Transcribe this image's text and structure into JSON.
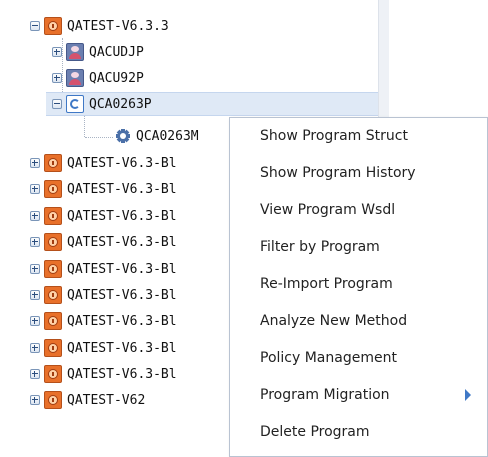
{
  "tree": {
    "items": [
      {
        "label": "QATEST-V6.3.3",
        "icon": "system-icon",
        "expander": "collapse"
      },
      {
        "label": "QACUDJP",
        "icon": "library-icon",
        "expander": "expand"
      },
      {
        "label": "QACU92P",
        "icon": "library-icon",
        "expander": "expand"
      },
      {
        "label": "QCA0263P",
        "icon": "program-icon",
        "expander": "collapse"
      },
      {
        "label": "QCA0263M",
        "icon": "gear-icon",
        "expander": "none"
      },
      {
        "label": "QATEST-V6.3-Bl",
        "icon": "system-icon",
        "expander": "expand"
      },
      {
        "label": "QATEST-V6.3-Bl",
        "icon": "system-icon",
        "expander": "expand"
      },
      {
        "label": "QATEST-V6.3-Bl",
        "icon": "system-icon",
        "expander": "expand"
      },
      {
        "label": "QATEST-V6.3-Bl",
        "icon": "system-icon",
        "expander": "expand"
      },
      {
        "label": "QATEST-V6.3-Bl",
        "icon": "system-icon",
        "expander": "expand"
      },
      {
        "label": "QATEST-V6.3-Bl",
        "icon": "system-icon",
        "expander": "expand"
      },
      {
        "label": "QATEST-V6.3-Bl",
        "icon": "system-icon",
        "expander": "expand"
      },
      {
        "label": "QATEST-V6.3-Bl",
        "icon": "system-icon",
        "expander": "expand"
      },
      {
        "label": "QATEST-V6.3-Bl",
        "icon": "system-icon",
        "expander": "expand"
      },
      {
        "label": "QATEST-V62",
        "icon": "system-icon",
        "expander": "expand"
      }
    ]
  },
  "context_menu": {
    "items": [
      {
        "label": "Show Program Struct"
      },
      {
        "label": "Show Program History"
      },
      {
        "label": "View Program Wsdl"
      },
      {
        "label": "Filter by Program"
      },
      {
        "label": "Re-Import Program"
      },
      {
        "label": "Analyze New Method"
      },
      {
        "label": "Policy Management"
      },
      {
        "label": "Program Migration",
        "submenu": true
      },
      {
        "label": "Delete Program"
      }
    ]
  },
  "colors": {
    "selected_row": "#dfe9f6",
    "menu_border": "#b9c3d2",
    "system_icon": "#e8702a",
    "submenu_arrow": "#3f78c6"
  }
}
